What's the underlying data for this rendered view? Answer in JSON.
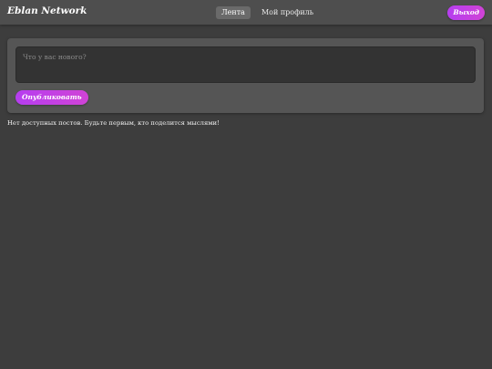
{
  "header": {
    "brand": "Eblan Network",
    "nav": [
      {
        "label": "Лента",
        "active": true
      },
      {
        "label": "Мой профиль",
        "active": false
      }
    ],
    "logout_label": "Выход"
  },
  "composer": {
    "placeholder": "Что у вас нового?",
    "value": "",
    "publish_label": "Опубликовать"
  },
  "feed": {
    "empty_message": "Нет доступных постов. Будьте первым, кто поделится мыслями!"
  },
  "colors": {
    "background": "#3d3d3d",
    "navbar": "#4e4e4e",
    "accent": "#c040e0",
    "card": "#555555"
  }
}
